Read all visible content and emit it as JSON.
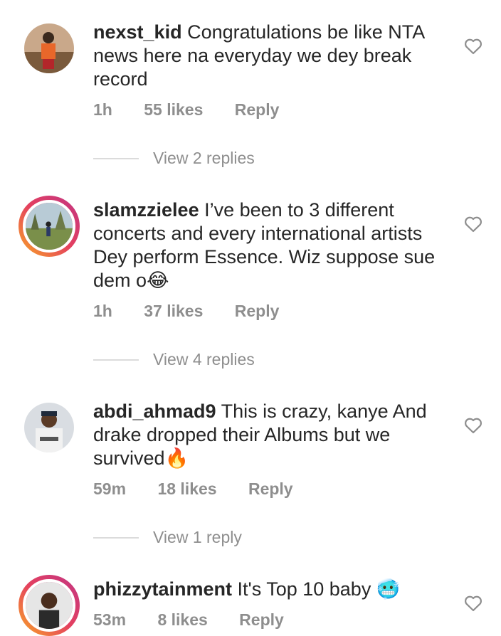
{
  "comments": [
    {
      "username": "nexst_kid",
      "text": "Congratulations be like NTA news here na everyday we dey break record",
      "time": "1h",
      "likes": "55 likes",
      "reply_label": "Reply",
      "view_replies": "View 2 replies"
    },
    {
      "username": "slamzzielee",
      "text": "I’ve been to 3 different concerts and every international artists Dey perform Essence. Wiz suppose sue dem o😂",
      "time": "1h",
      "likes": "37 likes",
      "reply_label": "Reply",
      "view_replies": "View 4 replies"
    },
    {
      "username": "abdi_ahmad9",
      "text": "This is crazy, kanye And drake dropped their Albums but we survived🔥",
      "time": "59m",
      "likes": "18 likes",
      "reply_label": "Reply",
      "view_replies": "View 1 reply"
    },
    {
      "username": "phizzytainment",
      "text": "It's Top 10 baby 🥶",
      "time": "53m",
      "likes": "8 likes",
      "reply_label": "Reply"
    }
  ],
  "icons": {
    "like": "heart-outline-icon"
  },
  "colors": {
    "text": "#262626",
    "meta": "#8e8e8e",
    "story_ring": "#e4405f"
  }
}
